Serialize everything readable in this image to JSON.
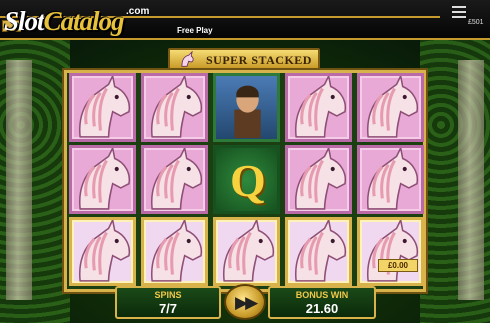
{
  "header": {
    "logo_part1": "Slot",
    "logo_part2": "Catalog",
    "logo_suffix": ".com",
    "mode_label": "Free Play",
    "balance": "£501"
  },
  "banner": {
    "label": "SUPER STACKED"
  },
  "reels": {
    "symbols": [
      [
        "unicorn",
        "unicorn",
        "unicorn-gold"
      ],
      [
        "unicorn",
        "unicorn",
        "unicorn-gold"
      ],
      [
        "hero",
        "Q",
        "unicorn-gold"
      ],
      [
        "unicorn",
        "unicorn",
        "unicorn-gold"
      ],
      [
        "unicorn",
        "unicorn",
        "unicorn-gold"
      ]
    ],
    "q_letter": "Q",
    "line_win": "£0.00"
  },
  "footer": {
    "spins_label": "SPINS",
    "spins_value": "7/7",
    "bonus_label": "BONUS WIN",
    "bonus_value": "21.60"
  },
  "colors": {
    "gold": "#d8b24a",
    "pink_tile": "#e8a9d7",
    "green": "#1b4a18"
  }
}
